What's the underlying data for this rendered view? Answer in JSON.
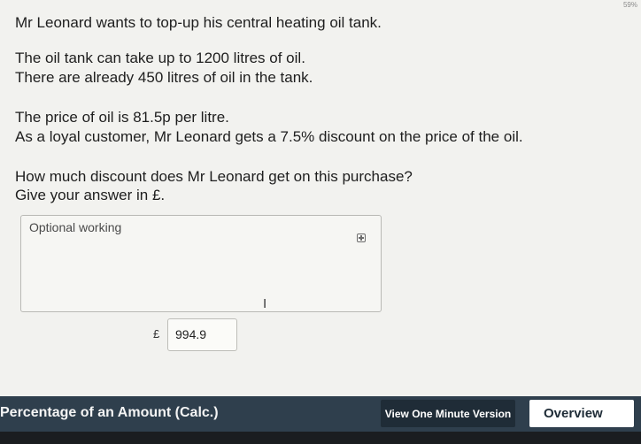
{
  "corner_mark": "59%",
  "question": {
    "line1": "Mr Leonard wants to top-up his central heating oil tank.",
    "line2": "The oil tank can take up to 1200 litres of oil.",
    "line3": "There are already 450 litres of oil in the tank.",
    "line4": "The price of oil is 81.5p per litre.",
    "line5": "As a loyal customer, Mr Leonard gets a 7.5% discount on the price of the oil.",
    "line6": "How much discount does Mr Leonard get on this purchase?",
    "line7": "Give your answer in £."
  },
  "working": {
    "label": "Optional working",
    "cursor_glyph": "I"
  },
  "answer": {
    "currency": "£",
    "value": "994.9"
  },
  "bottom_bar": {
    "topic": "Percentage of an Amount (Calc.)",
    "one_minute_label": "View One Minute Version",
    "overview_label": "Overview"
  },
  "colors": {
    "bar": "#2f3f4d",
    "button_dark": "#1f2c37",
    "background": "#f2f2ef"
  },
  "icons": {
    "expand": "plus-square-icon",
    "text_cursor": "text-cursor-icon"
  }
}
